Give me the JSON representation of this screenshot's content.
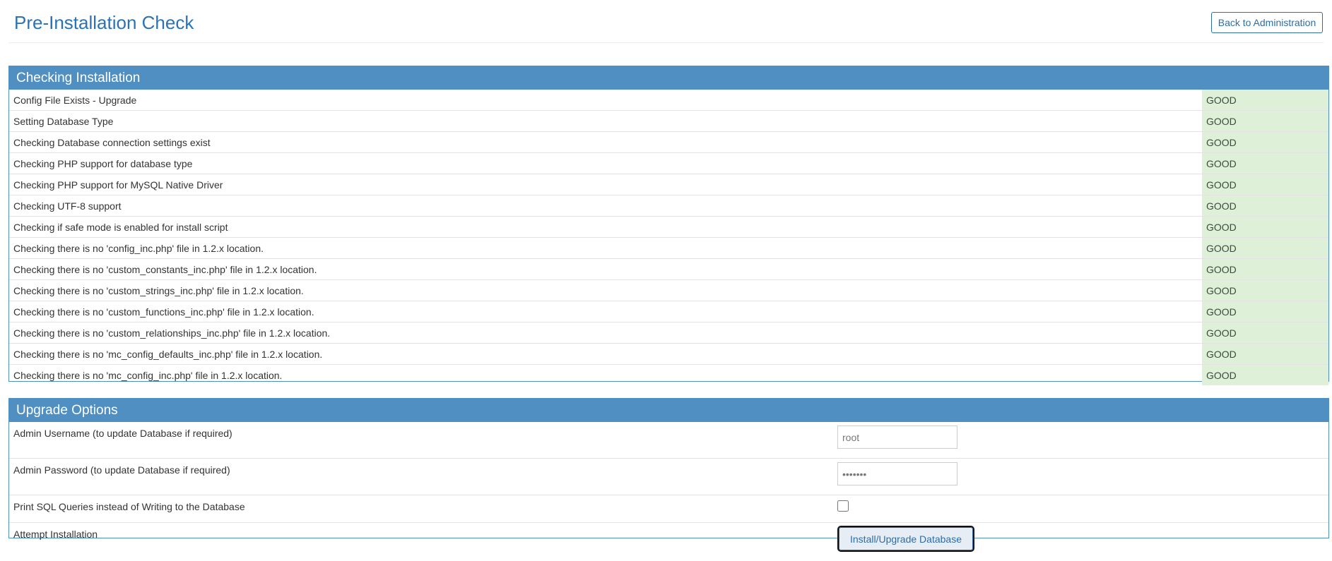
{
  "header": {
    "title": "Pre-Installation Check",
    "back_button_label": "Back to Administration"
  },
  "checking": {
    "heading": "Checking Installation",
    "status_color": "#dff0d8",
    "rows": [
      {
        "label": "Config File Exists - Upgrade",
        "status": "GOOD"
      },
      {
        "label": "Setting Database Type",
        "status": "GOOD"
      },
      {
        "label": "Checking Database connection settings exist",
        "status": "GOOD"
      },
      {
        "label": "Checking PHP support for database type",
        "status": "GOOD"
      },
      {
        "label": "Checking PHP support for MySQL Native Driver",
        "status": "GOOD"
      },
      {
        "label": "Checking UTF-8 support",
        "status": "GOOD"
      },
      {
        "label": "Checking if safe mode is enabled for install script",
        "status": "GOOD"
      },
      {
        "label": "Checking there is no 'config_inc.php' file in 1.2.x location.",
        "status": "GOOD"
      },
      {
        "label": "Checking there is no 'custom_constants_inc.php' file in 1.2.x location.",
        "status": "GOOD"
      },
      {
        "label": "Checking there is no 'custom_strings_inc.php' file in 1.2.x location.",
        "status": "GOOD"
      },
      {
        "label": "Checking there is no 'custom_functions_inc.php' file in 1.2.x location.",
        "status": "GOOD"
      },
      {
        "label": "Checking there is no 'custom_relationships_inc.php' file in 1.2.x location.",
        "status": "GOOD"
      },
      {
        "label": "Checking there is no 'mc_config_defaults_inc.php' file in 1.2.x location.",
        "status": "GOOD"
      },
      {
        "label": "Checking there is no 'mc_config_inc.php' file in 1.2.x location.",
        "status": "GOOD"
      }
    ]
  },
  "options": {
    "heading": "Upgrade Options",
    "admin_username_label": "Admin Username (to update Database if required)",
    "admin_username_value": "root",
    "admin_password_label": "Admin Password (to update Database if required)",
    "admin_password_value": "*******",
    "print_sql_label": "Print SQL Queries instead of Writing to the Database",
    "print_sql_checked": false,
    "attempt_label": "Attempt Installation",
    "install_button_label": "Install/Upgrade Database"
  },
  "colors": {
    "accent": "#4f8fc1",
    "title": "#2b73b4",
    "good": "#dff0d8"
  }
}
